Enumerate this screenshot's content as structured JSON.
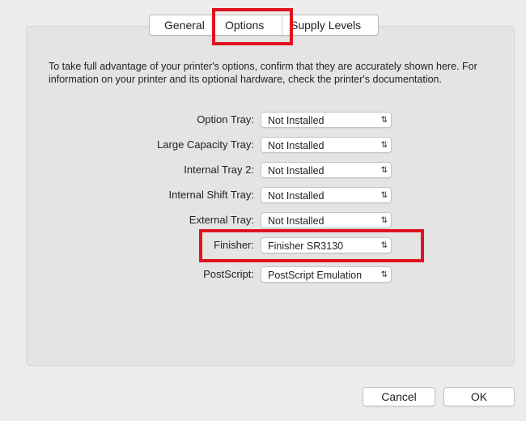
{
  "tabs": [
    "General",
    "Options",
    "Supply Levels"
  ],
  "description": "To take full advantage of your printer's options, confirm that they are accurately shown here. For information on your printer and its optional hardware, check the printer's documentation.",
  "options": [
    {
      "label": "Option Tray:",
      "value": "Not Installed"
    },
    {
      "label": "Large Capacity Tray:",
      "value": "Not Installed"
    },
    {
      "label": "Internal Tray 2:",
      "value": "Not Installed"
    },
    {
      "label": "Internal Shift Tray:",
      "value": "Not Installed"
    },
    {
      "label": "External Tray:",
      "value": "Not Installed"
    },
    {
      "label": "Finisher:",
      "value": "Finisher SR3130"
    },
    {
      "label": "PostScript:",
      "value": "PostScript Emulation"
    }
  ],
  "buttons": {
    "cancel": "Cancel",
    "ok": "OK"
  },
  "colors": {
    "highlight": "#e0141e",
    "background": "#ececec"
  },
  "icons": {
    "select": "up-down-chevron-icon"
  }
}
